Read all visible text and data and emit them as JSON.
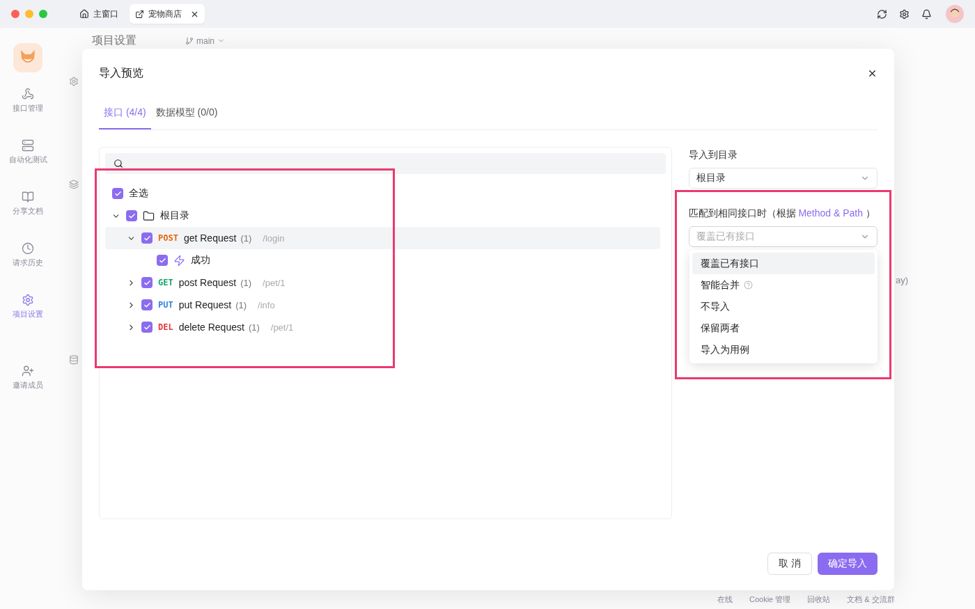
{
  "titlebar": {
    "tabs": [
      {
        "label": "主窗口",
        "selected": false,
        "closable": false
      },
      {
        "label": "宠物商店",
        "selected": true,
        "closable": true
      }
    ]
  },
  "sidebar": {
    "items": [
      {
        "label": "接口管理",
        "selected": false
      },
      {
        "label": "自动化测试",
        "selected": false
      },
      {
        "label": "分享文档",
        "selected": false
      },
      {
        "label": "请求历史",
        "selected": false
      },
      {
        "label": "项目设置",
        "selected": true
      },
      {
        "label": "邀请成员",
        "selected": false
      }
    ]
  },
  "page": {
    "title": "项目设置",
    "branch": "main",
    "fragment": "ay)"
  },
  "footer": [
    "在线",
    "Cookie 管理",
    "回收站",
    "文档 & 交流群"
  ],
  "dialog": {
    "title": "导入预览",
    "tabs": [
      {
        "label": "接口 (4/4)",
        "selected": true
      },
      {
        "label": "数据模型 (0/0)",
        "selected": false
      }
    ],
    "tree": {
      "highlighted": true,
      "rows": [
        {
          "kind": "select-all",
          "label": "全选",
          "checked": true
        },
        {
          "kind": "folder",
          "label": "根目录",
          "checked": true,
          "expanded": true,
          "children": [
            {
              "kind": "endpoint",
              "method": "POST",
              "color": "#e8650f",
              "name": "get Request",
              "count": "(1)",
              "path": "/login",
              "checked": true,
              "expanded": true,
              "hovered": true,
              "children": [
                {
                  "kind": "case",
                  "label": "成功",
                  "checked": true
                }
              ]
            },
            {
              "kind": "endpoint",
              "method": "GET",
              "color": "#14a66b",
              "name": "post Request",
              "count": "(1)",
              "path": "/pet/1",
              "checked": true,
              "expanded": false,
              "hovered": false
            },
            {
              "kind": "endpoint",
              "method": "PUT",
              "color": "#2f86e0",
              "name": "put Request",
              "count": "(1)",
              "path": "/info",
              "checked": true,
              "expanded": false,
              "hovered": false
            },
            {
              "kind": "endpoint",
              "method": "DEL",
              "color": "#e5383b",
              "name": "delete Request",
              "count": "(1)",
              "path": "/pet/1",
              "checked": true,
              "expanded": false,
              "hovered": false
            }
          ]
        }
      ]
    },
    "target": {
      "label": "导入到目录",
      "value": "根目录"
    },
    "conflict": {
      "highlighted": true,
      "label": "匹配到相同接口时（根据",
      "accent": "Method & Path",
      "label_end": "）",
      "placeholder": "覆盖已有接口",
      "open": true,
      "options": [
        {
          "label": "覆盖已有接口",
          "selected": true,
          "help": false
        },
        {
          "label": "智能合并",
          "selected": false,
          "help": true
        },
        {
          "label": "不导入",
          "selected": false,
          "help": false
        },
        {
          "label": "保留两者",
          "selected": false,
          "help": false
        },
        {
          "label": "导入为用例",
          "selected": false,
          "help": false
        }
      ]
    },
    "buttons": [
      {
        "label": "取 消",
        "kind": "secondary"
      },
      {
        "label": "确定导入",
        "kind": "primary"
      }
    ]
  }
}
